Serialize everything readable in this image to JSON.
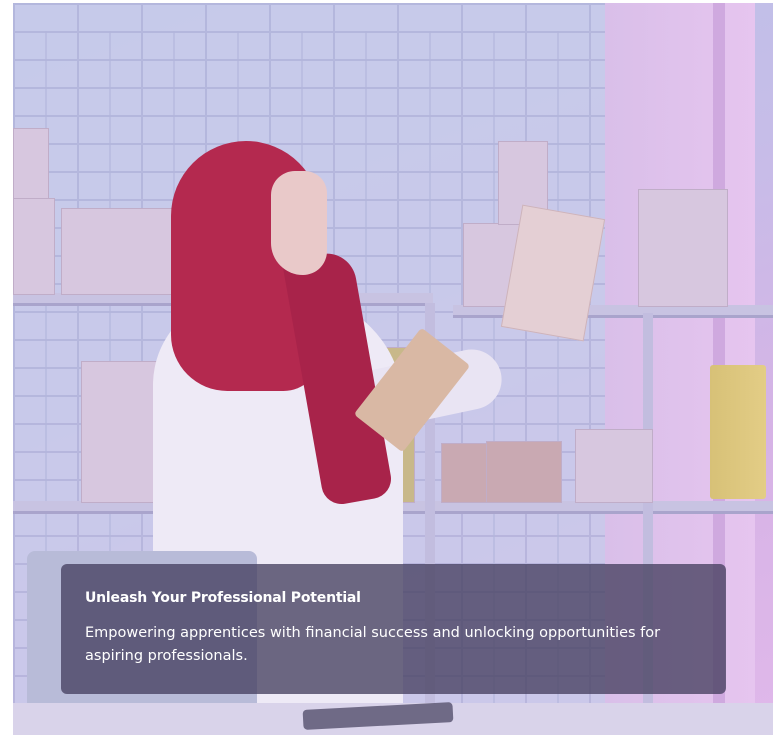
{
  "hero": {
    "image_alt_icon": "woman-with-packages-photo",
    "gradient_colors": [
      "#b9c3e8",
      "#d6b3e6",
      "#e0b8ea"
    ],
    "overlay": {
      "title": "Unleash Your Professional Potential",
      "description": "Empowering apprentices with financial success and unlocking opportunities for aspiring professionals."
    }
  }
}
